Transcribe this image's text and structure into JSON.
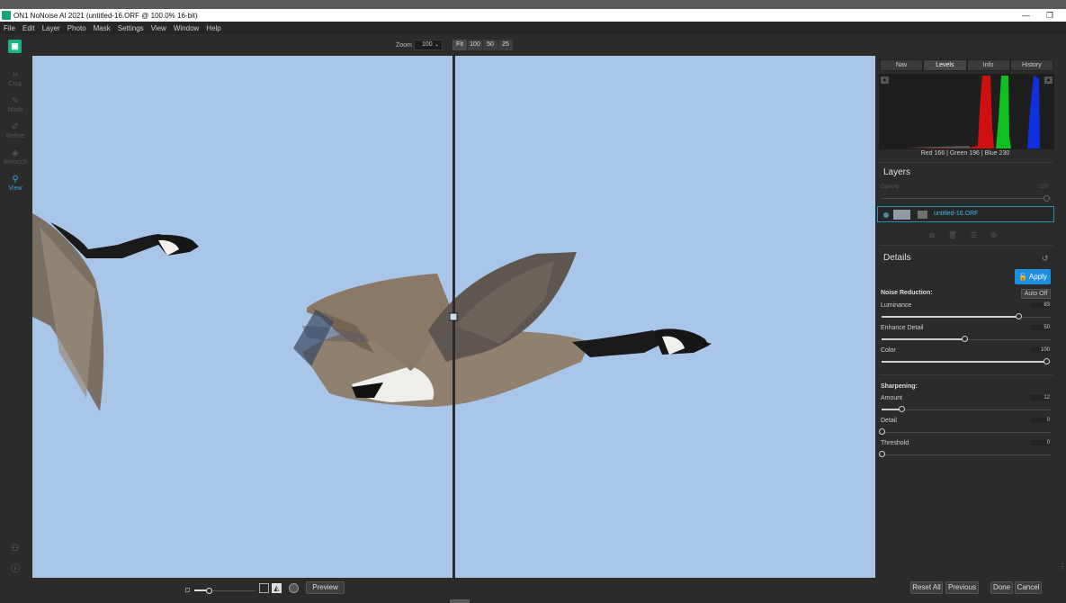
{
  "window": {
    "title": "ON1 NoNoise AI 2021 (untitled-16.ORF @ 100.0% 16-bit)",
    "minimize": "—",
    "restore": "❐"
  },
  "menu": [
    "File",
    "Edit",
    "Layer",
    "Photo",
    "Mask",
    "Settings",
    "View",
    "Window",
    "Help"
  ],
  "toolbar": {
    "zoom_label": "Zoom",
    "zoom_value": "100",
    "zoom_presets": [
      "Fit",
      "100",
      "50",
      "25"
    ]
  },
  "left_tools": [
    {
      "label": "Crop",
      "icon": "crop-icon",
      "glyph": "⌗"
    },
    {
      "label": "Mask",
      "icon": "mask-brush-icon",
      "glyph": "✎"
    },
    {
      "label": "Refine",
      "icon": "refine-brush-icon",
      "glyph": "✐"
    },
    {
      "label": "Retouch",
      "icon": "retouch-icon",
      "glyph": "◈"
    },
    {
      "label": "View",
      "icon": "view-zoom-icon",
      "glyph": "⚲",
      "active": true
    }
  ],
  "bottom_left_icons": [
    "user-settings-icon",
    "help-icon"
  ],
  "bottom": {
    "preview_label": "Preview",
    "reset_all_label": "Reset All",
    "previous_label": "Previous",
    "done_label": "Done",
    "cancel_label": "Cancel"
  },
  "panel": {
    "tabs": [
      "Nav",
      "Levels",
      "Info",
      "History"
    ],
    "active_tab": "Levels",
    "rgb_readout": "Red 166  | Green 196  | Blue 230",
    "layers_title": "Layers",
    "opacity_label": "Opacity",
    "opacity_value": "100",
    "layer_name": "untitled-16.ORF",
    "details_title": "Details",
    "apply_label": "Apply",
    "noise_reduction_label": "Noise Reduction:",
    "auto_off_label": "Auto Off",
    "sliders_nr": [
      {
        "label": "Luminance",
        "value": "83",
        "level": 0.83
      },
      {
        "label": "Enhance Detail",
        "value": "50",
        "level": 0.5
      },
      {
        "label": "Color",
        "value": "100",
        "level": 1.0
      }
    ],
    "sharpening_label": "Sharpening:",
    "sliders_sh": [
      {
        "label": "Amount",
        "value": "12",
        "level": 0.12
      },
      {
        "label": "Detail",
        "value": "0",
        "level": 0
      },
      {
        "label": "Threshold",
        "value": "0",
        "level": 0
      }
    ]
  },
  "colors": {
    "accent": "#1e8fe0",
    "sky": "#a9c5e8",
    "histogram_red": "#d01010",
    "histogram_green": "#10c020",
    "histogram_blue": "#1030e0"
  }
}
